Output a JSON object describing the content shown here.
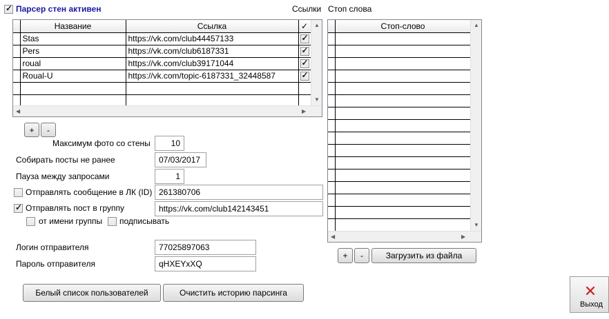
{
  "parser_active": {
    "label": "Парсер стен активен",
    "checked": true
  },
  "links_title": "Ссылки",
  "stopwords_title": "Стоп слова",
  "links_table": {
    "headers": [
      "Название",
      "Ссылка",
      "✓"
    ],
    "rows": [
      {
        "name": "Stas",
        "url": "https://vk.com/club44457133",
        "checked": true
      },
      {
        "name": "Pers",
        "url": "https://vk.com/club6187331",
        "checked": true
      },
      {
        "name": "roual",
        "url": "https://vk.com/club39171044",
        "checked": true
      },
      {
        "name": "Roual-U",
        "url": "https://vk.com/topic-6187331_32448587",
        "checked": true
      }
    ]
  },
  "links_add": "+",
  "links_remove": "-",
  "max_photo": {
    "label": "Максимум фото со стены",
    "value": "10"
  },
  "collect_since": {
    "label": "Собирать посты не ранее",
    "value": "07/03/2017"
  },
  "pause": {
    "label": "Пауза между запросами",
    "value": "1"
  },
  "send_message": {
    "label": "Отправлять сообщение в ЛК (ID)",
    "checked": false,
    "value": "261380706"
  },
  "send_post": {
    "label": "Отправлять пост в группу",
    "checked": true,
    "value": "https://vk.com/club142143451"
  },
  "as_group": {
    "label": "от имени группы",
    "checked": false
  },
  "sign": {
    "label": "подписывать",
    "checked": false
  },
  "sender_login": {
    "label": "Логин отправителя",
    "value": "77025897063"
  },
  "sender_password": {
    "label": "Пароль отправителя",
    "value": "qHXEYxXQ"
  },
  "whitelist_button": "Белый список пользователей",
  "clear_history_button": "Очистить историю парсинга",
  "stop_table": {
    "header": "Стоп-слово"
  },
  "stop_add": "+",
  "stop_remove": "-",
  "load_file_button": "Загрузить из файла",
  "exit_button": "Выход",
  "colors": {
    "exit_icon": "#cc1f1f",
    "title_text": "#1a1aa6"
  }
}
